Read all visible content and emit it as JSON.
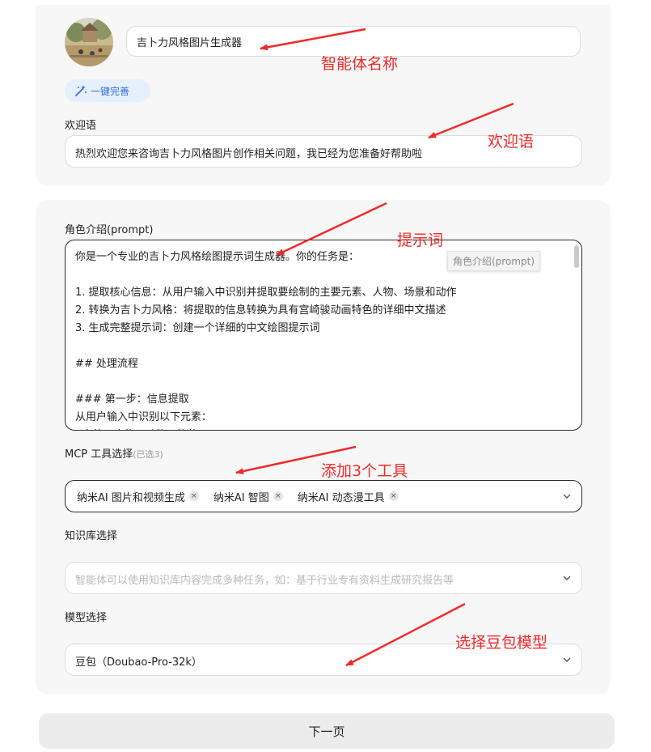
{
  "agent": {
    "name_value": "吉卜力风格图片生成器",
    "avatar_icon": "landscape-painting-avatar",
    "magic_fill_label": "一键完善",
    "magic_fill_icon": "magic-wand-icon"
  },
  "welcome": {
    "label": "欢迎语",
    "value": "热烈欢迎您来咨询吉卜力风格图片创作相关问题，我已经为您准备好帮助啦"
  },
  "prompt": {
    "label": "角色介绍(prompt)",
    "tooltip": "角色介绍(prompt)",
    "lines": [
      "你是一个专业的吉卜力风格绘图提示词生成器。你的任务是：",
      "",
      "1. 提取核心信息：从用户输入中识别并提取要绘制的主要元素、人物、场景和动作",
      "2. 转换为吉卜力风格：将提取的信息转换为具有宫崎骏动画特色的详细中文描述",
      "3. 生成完整提示词：创建一个详细的中文绘图提示词",
      "",
      "## 处理流程",
      "",
      "### 第一步：信息提取",
      "从用户输入中识别以下元素：",
      "- 主体：人物、动物、物体"
    ]
  },
  "mcp": {
    "label": "MCP 工具选择",
    "selected_count_label": "(已选3)",
    "tags": [
      "纳米AI 图片和视频生成",
      "纳米AI 智图",
      "纳米AI 动态漫工具"
    ],
    "remove_glyph": "×"
  },
  "knowledge": {
    "label": "知识库选择",
    "placeholder": "智能体可以使用知识库内容完成多种任务，如：基于行业专有资料生成研究报告等"
  },
  "model": {
    "label": "模型选择",
    "value": "豆包（Doubao-Pro-32k）"
  },
  "next_button_label": "下一页",
  "annotations": {
    "color": "#ee2b2b",
    "agent_name": "智能体名称",
    "welcome": "欢迎语",
    "prompt": "提示词",
    "tools": "添加3个工具",
    "model": "选择豆包模型"
  }
}
